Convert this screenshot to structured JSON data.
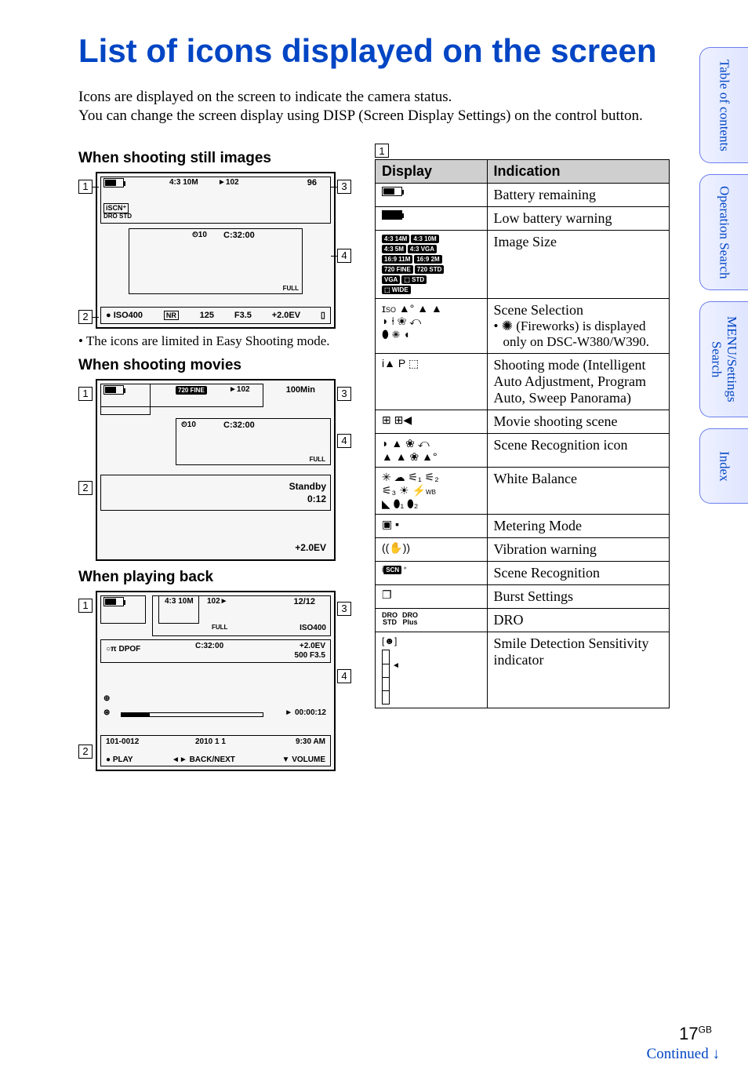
{
  "page": {
    "title": "List of icons displayed on the screen",
    "intro_line1": "Icons are displayed on the screen to indicate the camera status.",
    "intro_line2": "You can change the screen display using DISP (Screen Display Settings) on the control button.",
    "page_number": "17",
    "page_lang": "GB",
    "continued": "Continued ↓"
  },
  "tabs": {
    "t1": "Table of contents",
    "t2": "Operation Search",
    "t3": "MENU/Settings Search",
    "t4": "Index"
  },
  "sections": {
    "still_heading": "When shooting still images",
    "movie_heading": "When shooting movies",
    "play_heading": "When playing back",
    "note_still": "• The icons are limited in Easy Shooting mode."
  },
  "callouts": {
    "c1": "1",
    "c2": "2",
    "c3": "3",
    "c4": "4"
  },
  "still_screen": {
    "size": "4:3 10M",
    "folder": "►102",
    "remaining": "96",
    "timer": "C:32:00",
    "iso": "ISO400",
    "nr": "NR",
    "shutter": "125",
    "aperture": "F3.5",
    "ev": "+2.0EV",
    "scn": "iSCN⁺",
    "dro": "DRO STD",
    "full": "FULL",
    "selftimer_icon": "⏲10"
  },
  "movie_screen": {
    "mode": "720 FINE",
    "folder": "►102",
    "time": "100Min",
    "ccode": "C:32:00",
    "standby": "Standby",
    "elapsed": "0:12",
    "ev": "+2.0EV",
    "full": "FULL",
    "selftimer_icon": "⏲10"
  },
  "play_screen": {
    "size": "4:3 10M",
    "folder": "102►",
    "counter": "12/12",
    "iso": "ISO400",
    "ccode": "C:32:00",
    "ev": "+2.0EV",
    "exp": "500  F3.5",
    "dpof": "DPOF",
    "full": "FULL",
    "clip": "00:00:12",
    "filebase": "101-0012",
    "date": "2010  1  1",
    "clock": "9:30 AM",
    "play": "● PLAY",
    "nav": "◄► BACK/NEXT",
    "vol": "▼ VOLUME"
  },
  "table_header": {
    "display": "Display",
    "indication": "Indication"
  },
  "region_marker": "1",
  "rows": [
    {
      "icons_html": "battery",
      "indication": "Battery remaining"
    },
    {
      "icons_html": "lowbatt",
      "indication": "Low battery warning"
    },
    {
      "icons_html": "imagesize",
      "indication": "Image Size",
      "sizes": [
        "4:3 14M",
        "4:3 10M",
        "4:3 5M",
        "4:3 VGA",
        "16:9 11M",
        "16:9 2M",
        "720 FINE",
        "720 STD",
        "VGA",
        "⬚ STD",
        "⬚ WIDE"
      ]
    },
    {
      "icons_html": "scene",
      "indication": "Scene Selection",
      "sub": "• ✺ (Fireworks) is displayed only on DSC-W380/W390."
    },
    {
      "icons_html": "shootmode",
      "indication": "Shooting mode (Intelligent Auto Adjustment, Program Auto, Sweep Panorama)"
    },
    {
      "icons_html": "movieicon",
      "indication": "Movie shooting scene"
    },
    {
      "icons_html": "scenerec",
      "indication": "Scene Recognition icon"
    },
    {
      "icons_html": "wb",
      "indication": "White Balance"
    },
    {
      "icons_html": "metering",
      "indication": "Metering Mode"
    },
    {
      "icons_html": "vibration",
      "indication": "Vibration warning"
    },
    {
      "icons_html": "iscn",
      "indication": "Scene Recognition"
    },
    {
      "icons_html": "burst",
      "indication": "Burst Settings"
    },
    {
      "icons_html": "dro",
      "indication": "DRO"
    },
    {
      "icons_html": "smile",
      "indication": "Smile Detection Sensitivity indicator"
    }
  ]
}
